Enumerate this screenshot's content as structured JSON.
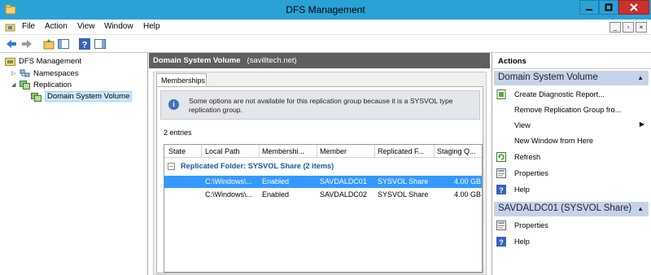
{
  "window": {
    "title": "DFS Management"
  },
  "menu": [
    "File",
    "Action",
    "View",
    "Window",
    "Help"
  ],
  "tree": {
    "root": "DFS Management",
    "namespaces": "Namespaces",
    "replication": "Replication",
    "selected": "Domain System Volume"
  },
  "center": {
    "header_name": "Domain System Volume",
    "header_domain": "(savilltech.net)",
    "tab": "Memberships",
    "info_text": "Some options are not available for this replication group because it is a SYSVOL type replication group.",
    "entries": "2 entries",
    "columns": [
      "State",
      "Local Path",
      "Membershi...",
      "Member",
      "Replicated F...",
      "Staging Q..."
    ],
    "group_label": "Replicated Folder: SYSVOL Share (2 items)",
    "group_toggle": "−",
    "rows": [
      {
        "state": "",
        "path": "C:\\Windows\\...",
        "membership": "Enabled",
        "member": "SAVDALDC01",
        "folder": "SYSVOL Share",
        "staging": "4.00 GB",
        "selected": true
      },
      {
        "state": "",
        "path": "C:\\Windows\\...",
        "membership": "Enabled",
        "member": "SAVDALDC02",
        "folder": "SYSVOL Share",
        "staging": "4.00 GB",
        "selected": false
      }
    ]
  },
  "actions": {
    "title": "Actions",
    "section1": {
      "title": "Domain System Volume",
      "items": [
        {
          "label": "Create Diagnostic Report...",
          "icon": "report-icon"
        },
        {
          "label": "Remove Replication Group fro...",
          "icon": "none"
        },
        {
          "label": "View",
          "icon": "none",
          "submenu": true
        },
        {
          "label": "New Window from Here",
          "icon": "none"
        },
        {
          "label": "Refresh",
          "icon": "refresh-icon"
        },
        {
          "label": "Properties",
          "icon": "properties-icon"
        },
        {
          "label": "Help",
          "icon": "help-icon"
        }
      ]
    },
    "section2": {
      "title": "SAVDALDC01 (SYSVOL Share)",
      "items": [
        {
          "label": "Properties",
          "icon": "properties-icon"
        },
        {
          "label": "Help",
          "icon": "help-icon"
        }
      ]
    }
  },
  "colors": {
    "titlebar": "#2aa2d6",
    "close_button": "#c8322a",
    "selected_row": "#3399ff",
    "section_header": "#c5d3e8",
    "group_text": "#1d55a0"
  }
}
